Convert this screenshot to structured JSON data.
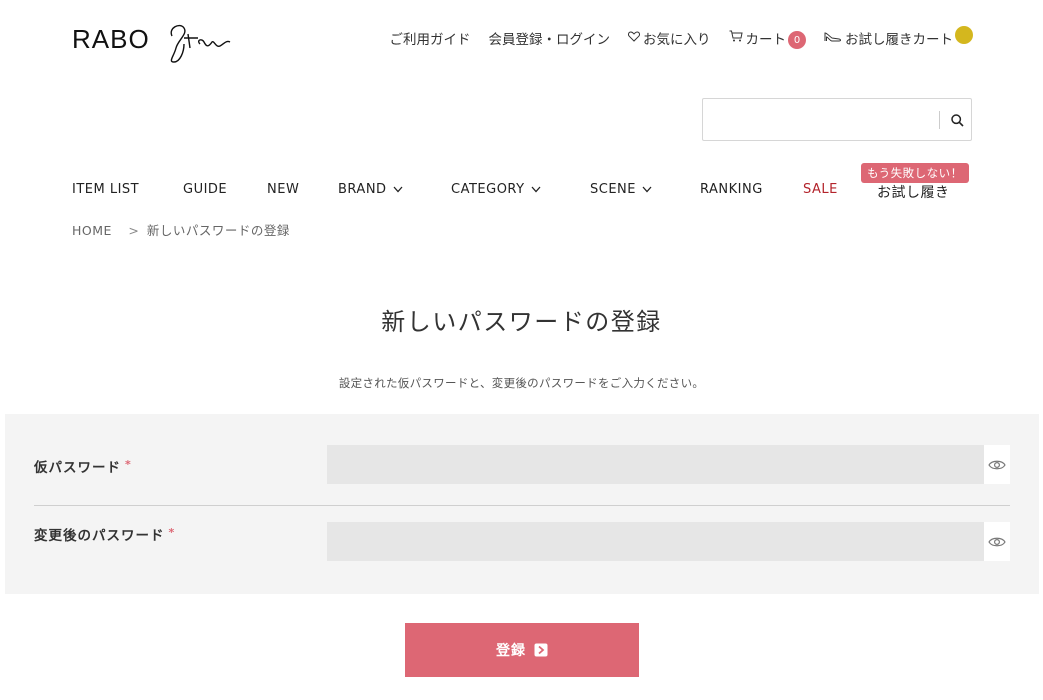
{
  "header": {
    "logo_text": "RABO",
    "links": {
      "guide": "ご利用ガイド",
      "member": "会員登録・ログイン",
      "favorites": "お気に入り",
      "cart": "カート",
      "cart_count": "0",
      "trial_cart": "お試し履きカート"
    },
    "search": {
      "placeholder": ""
    }
  },
  "nav": {
    "items": [
      "ITEM LIST",
      "GUIDE",
      "NEW",
      "BRAND",
      "CATEGORY",
      "SCENE",
      "RANKING",
      "SALE"
    ],
    "trial_label": "お試し履き",
    "trial_tag": "もう失敗しない！"
  },
  "breadcrumb": {
    "home": "HOME",
    "sep": ">",
    "current": "新しいパスワードの登録"
  },
  "main": {
    "title": "新しいパスワードの登録",
    "intro": "設定された仮パスワードと、変更後のパスワードをご入力ください。",
    "fields": [
      {
        "label": "仮パスワード",
        "required": "*",
        "value": ""
      },
      {
        "label": "変更後のパスワード",
        "required": "*",
        "value": ""
      }
    ],
    "submit_label": "登録"
  },
  "colors": {
    "accent": "#dd6774",
    "sale": "#b3232b",
    "trial_badge": "#d4b71e",
    "panel": "#f4f4f4"
  }
}
